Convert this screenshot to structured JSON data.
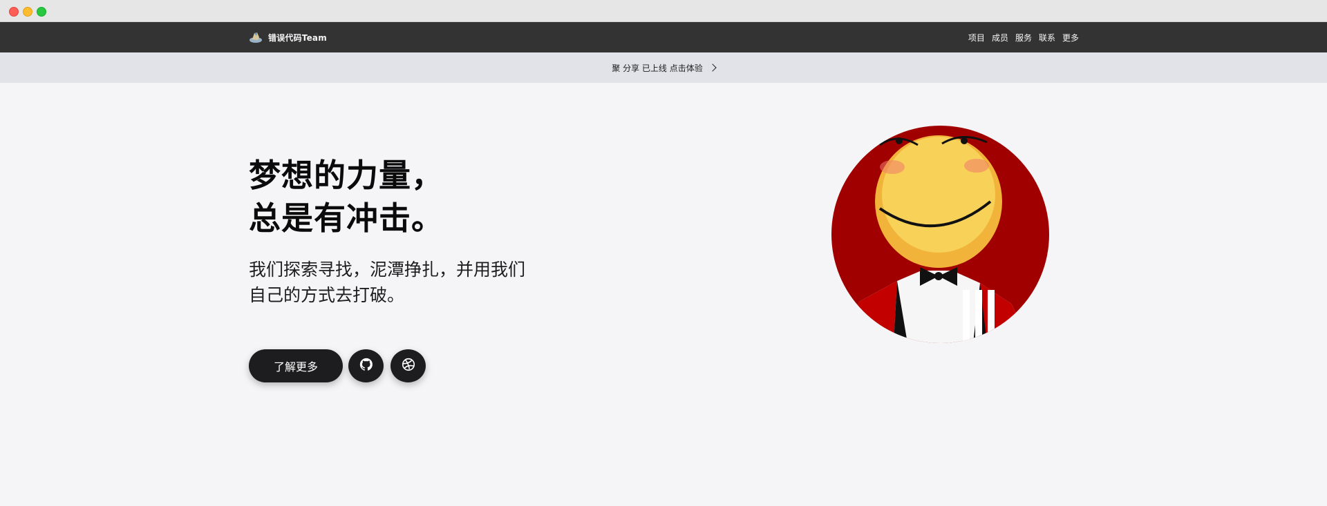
{
  "window": {
    "controls": [
      "close",
      "minimize",
      "maximize"
    ]
  },
  "nav": {
    "brand": "错误代码Team",
    "links": [
      "项目",
      "成员",
      "服务",
      "联系",
      "更多"
    ]
  },
  "announcement": {
    "text": "聚 分享 已上线 点击体验",
    "icon": "chevron-right-icon"
  },
  "hero": {
    "title_line1": "梦想的力量，",
    "title_line2": "总是有冲击。",
    "subtitle": "我们探索寻找，泥潭挣扎，并用我们自己的方式去打破。",
    "cta_label": "了解更多",
    "icons": [
      "github-icon",
      "dribbble-icon"
    ],
    "image": "smiley-avatar-red-circle"
  },
  "colors": {
    "nav_bg": "#333333",
    "announce_bg": "#e2e3e8",
    "page_bg": "#f5f5f7",
    "button_bg": "#1d1d1f",
    "avatar_red": "#a10000"
  }
}
